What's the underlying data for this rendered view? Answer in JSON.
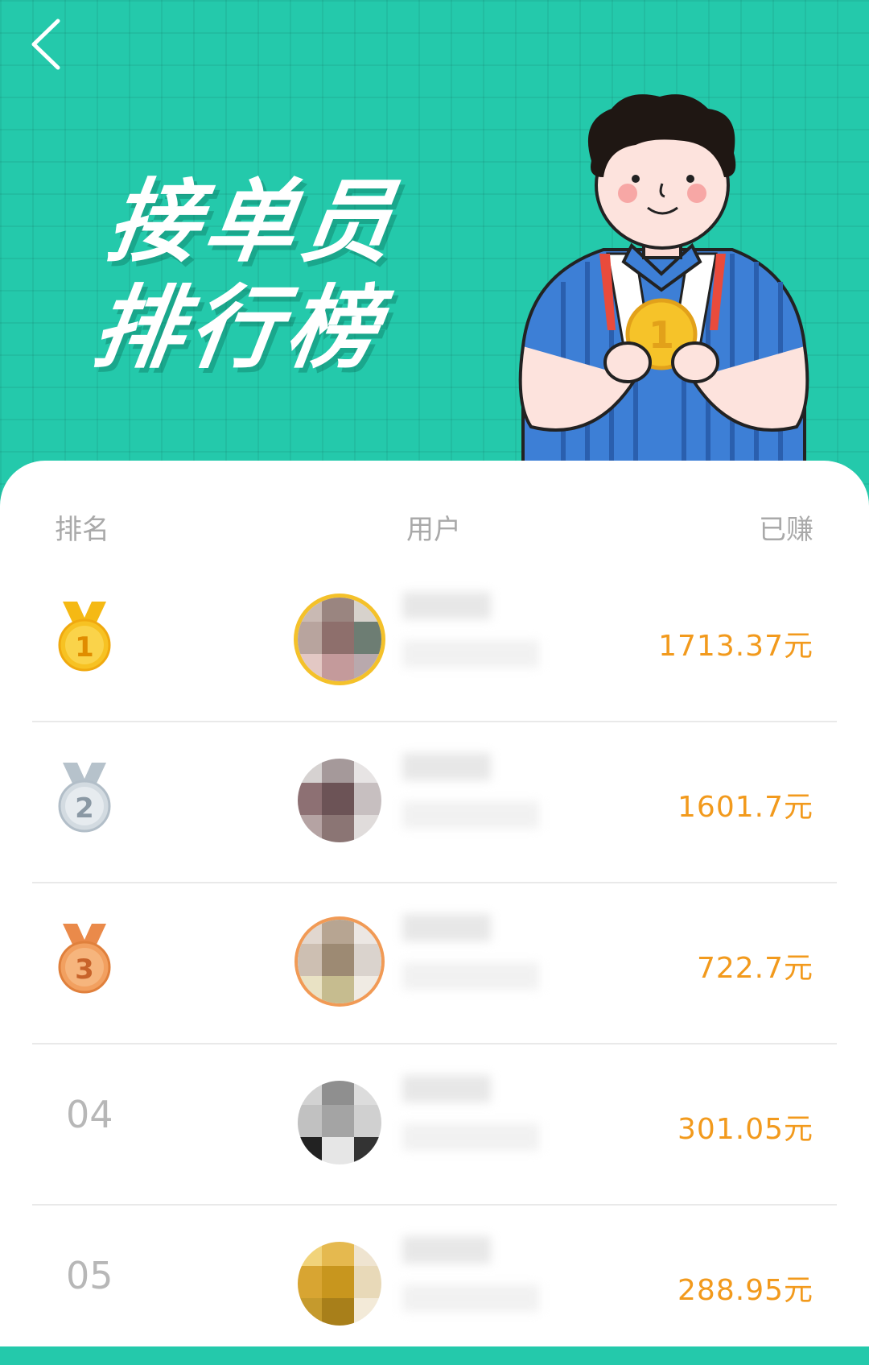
{
  "header": {
    "title_line1": "接单员",
    "title_line2": "排行榜"
  },
  "table": {
    "col_rank": "排名",
    "col_user": "用户",
    "col_earned": "已赚"
  },
  "rows": [
    {
      "rank": "1",
      "rank_display": "medal-gold-icon",
      "earned": "1713.37元"
    },
    {
      "rank": "2",
      "rank_display": "medal-silver-icon",
      "earned": "1601.7元"
    },
    {
      "rank": "3",
      "rank_display": "medal-bronze-icon",
      "earned": "722.7元"
    },
    {
      "rank": "04",
      "rank_display": "text",
      "earned": "301.05元"
    },
    {
      "rank": "05",
      "rank_display": "text",
      "earned": "288.95元"
    }
  ],
  "colors": {
    "header_bg": "#24c9ab",
    "earned_text": "#f29a1d",
    "gold": "#f4c12a",
    "silver": "#c9d3db",
    "bronze": "#f19a55"
  }
}
